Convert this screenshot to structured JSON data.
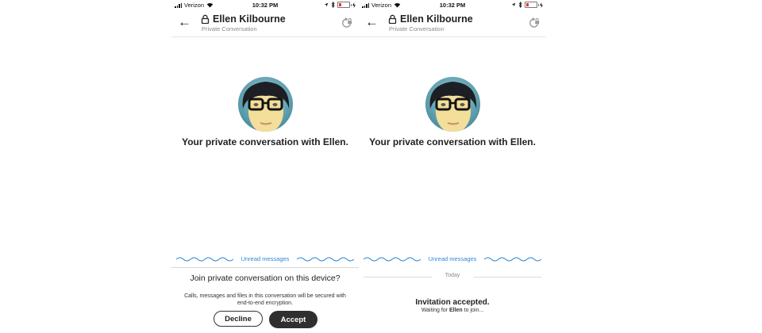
{
  "status_bar": {
    "carrier": "Verizon",
    "time": "10:32 PM"
  },
  "header": {
    "title": "Ellen Kilbourne",
    "subtitle": "Private Conversation"
  },
  "conversation": {
    "headline": "Your private conversation with Ellen.",
    "unread_label": "Unread messages"
  },
  "join_prompt": {
    "title": "Join private conversation on this device?",
    "description": "Calls, messages and files in this conversation will be secured with end-to-end encryption.",
    "decline_label": "Decline",
    "accept_label": "Accept"
  },
  "accepted": {
    "date_divider": "Today",
    "title": "Invitation accepted.",
    "waiting_prefix": "Waiting for",
    "waiting_name": "Ellen",
    "waiting_suffix": "to join..."
  },
  "colors": {
    "accent": "#2e88d6",
    "accept_button": "#2f2f2f",
    "battery_low": "#e53935"
  },
  "icons": [
    "back-arrow-icon",
    "lock-icon",
    "refresh-lock-icon",
    "wifi-icon",
    "location-icon",
    "bluetooth-icon",
    "battery-icon",
    "charging-icon"
  ]
}
